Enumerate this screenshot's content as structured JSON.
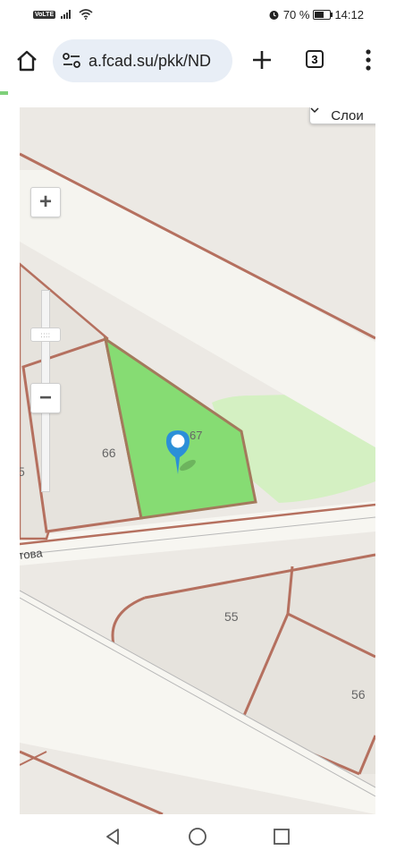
{
  "status": {
    "network_badge": "VoLTE",
    "battery_pct": "70 %",
    "battery_level": 0.7,
    "time": "14:12"
  },
  "browser": {
    "url": "a.fcad.su/pkk/ND",
    "tab_count": "3",
    "icons": [
      "home-icon",
      "site-settings-icon",
      "new-tab-icon",
      "tabs-icon",
      "menu-icon"
    ]
  },
  "map": {
    "layers_label": "Слои",
    "parcels": {
      "p55": "55",
      "p56": "56",
      "p66": "66",
      "p67": "67",
      "p65_partial": "5"
    },
    "street_label": "това",
    "zoom_in": "+",
    "zoom_out": "−",
    "colors": {
      "boundary": "#b5705f",
      "selected_fill": "#86dc73",
      "park_fill": "#d4f0c2",
      "road_fill": "#f7f6f1",
      "pin": "#2b8fd8"
    }
  },
  "nav": {
    "icons": [
      "back-icon",
      "home-circle-icon",
      "recents-icon"
    ]
  }
}
